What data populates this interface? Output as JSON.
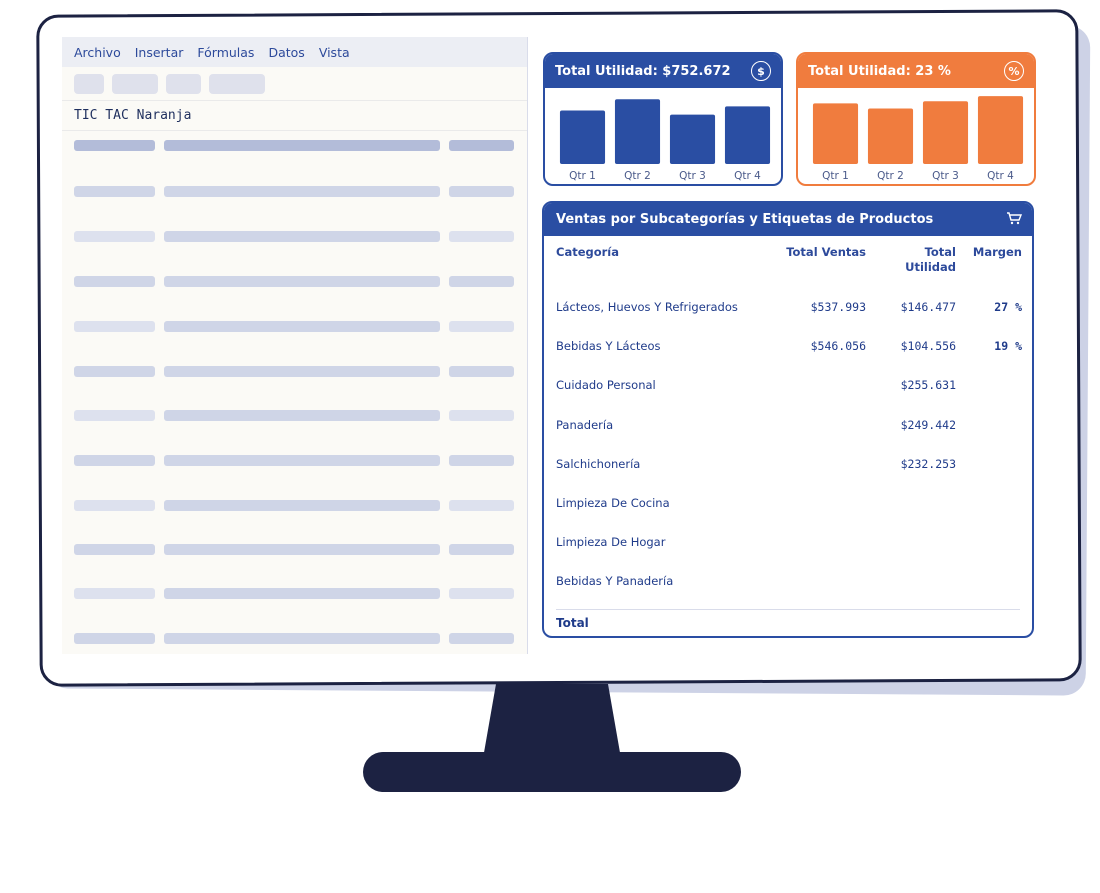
{
  "menu": [
    "Archivo",
    "Insertar",
    "Fórmulas",
    "Datos",
    "Vista"
  ],
  "sheet": {
    "title": "TIC TAC Naranja"
  },
  "kpis": [
    {
      "title": "Total Utilidad: $752.672",
      "icon": "dollar-icon",
      "icon_glyph": "$",
      "color": "#2a4ea3",
      "chart_type": "bar",
      "categories": [
        "Qtr 1",
        "Qtr 2",
        "Qtr 3",
        "Qtr 4"
      ]
    },
    {
      "title": "Total Utilidad: 23 %",
      "icon": "percent-icon",
      "icon_glyph": "%",
      "color": "#f07c3e",
      "chart_type": "bar",
      "categories": [
        "Qtr 1",
        "Qtr 2",
        "Qtr 3",
        "Qtr 4"
      ]
    }
  ],
  "table": {
    "title": "Ventas por Subcategorías y Etiquetas de Productos",
    "icon": "cart-icon",
    "headers": [
      "Categoría",
      "Total Ventas",
      "Total Utilidad",
      "Margen"
    ],
    "rows": [
      [
        "Lácteos, Huevos Y Refrigerados",
        "$537.993",
        "$146.477",
        "27 %"
      ],
      [
        "Bebidas Y Lácteos",
        "$546.056",
        "$104.556",
        "19 %"
      ],
      [
        "Cuidado Personal",
        "",
        "$255.631",
        ""
      ],
      [
        "Panadería",
        "",
        "$249.442",
        ""
      ],
      [
        "Salchichonería",
        "",
        "$232.253",
        ""
      ],
      [
        "Limpieza De Cocina",
        "",
        "",
        ""
      ],
      [
        "Limpieza De Hogar",
        "",
        "",
        ""
      ],
      [
        "Bebidas Y Panadería",
        "",
        "",
        ""
      ]
    ],
    "total_label": "Total"
  },
  "chart_data": [
    {
      "type": "bar",
      "categories": [
        "Qtr 1",
        "Qtr 2",
        "Qtr 3",
        "Qtr 4"
      ],
      "values": [
        52,
        63,
        48,
        56
      ],
      "title": "",
      "xlabel": "",
      "ylabel": ""
    },
    {
      "type": "bar",
      "categories": [
        "Qtr 1",
        "Qtr 2",
        "Qtr 3",
        "Qtr 4"
      ],
      "values": [
        59,
        54,
        61,
        66
      ],
      "title": "",
      "xlabel": "",
      "ylabel": ""
    }
  ]
}
